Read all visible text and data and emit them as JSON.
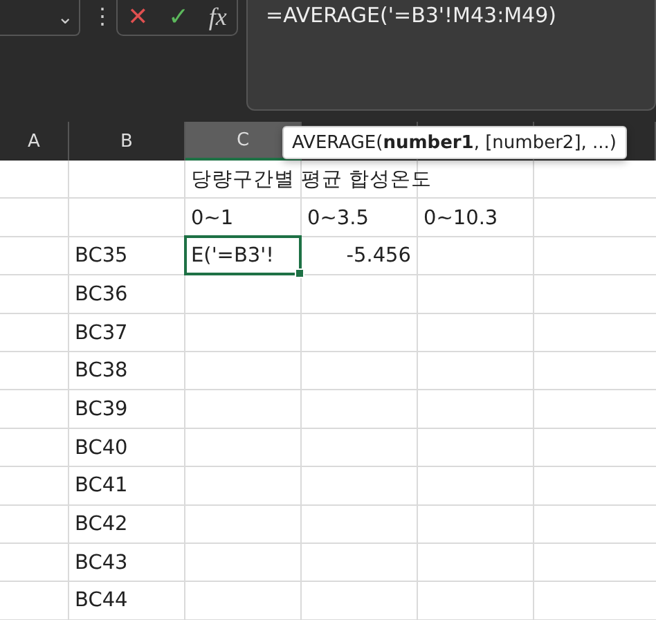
{
  "formula_bar": {
    "name_box": {
      "caret": "⌄"
    },
    "more": "⋮",
    "cancel": "✕",
    "enter": "✓",
    "function_label": "fx",
    "formula": "=AVERAGE('=B3'!M43:M49)"
  },
  "columns": [
    {
      "label": "A",
      "selected": false
    },
    {
      "label": "B",
      "selected": false
    },
    {
      "label": "C",
      "selected": true
    }
  ],
  "tooltip": "AVERAGE(**number1**, [number2], ...)",
  "rows": [
    {
      "cells": [
        null,
        null,
        {
          "text": "당량구간별 평균 합성온도",
          "kind": "text"
        },
        null,
        null,
        null
      ]
    },
    {
      "cells": [
        null,
        null,
        {
          "text": "0~1",
          "kind": "text"
        },
        {
          "text": "0~3.5",
          "kind": "text"
        },
        {
          "text": "0~10.3",
          "kind": "text"
        },
        null
      ]
    },
    {
      "cells": [
        null,
        {
          "text": "BC35",
          "kind": "text"
        },
        {
          "text": "E('=B3'!",
          "kind": "editing"
        },
        {
          "text": "-5.456",
          "kind": "number"
        },
        null,
        null
      ]
    },
    {
      "cells": [
        null,
        {
          "text": "BC36",
          "kind": "text"
        },
        null,
        null,
        null,
        null
      ]
    },
    {
      "cells": [
        null,
        {
          "text": "BC37",
          "kind": "text"
        },
        null,
        null,
        null,
        null
      ]
    },
    {
      "cells": [
        null,
        {
          "text": "BC38",
          "kind": "text"
        },
        null,
        null,
        null,
        null
      ]
    },
    {
      "cells": [
        null,
        {
          "text": "BC39",
          "kind": "text"
        },
        null,
        null,
        null,
        null
      ]
    },
    {
      "cells": [
        null,
        {
          "text": "BC40",
          "kind": "text"
        },
        null,
        null,
        null,
        null
      ]
    },
    {
      "cells": [
        null,
        {
          "text": "BC41",
          "kind": "text"
        },
        null,
        null,
        null,
        null
      ]
    },
    {
      "cells": [
        null,
        {
          "text": "BC42",
          "kind": "text"
        },
        null,
        null,
        null,
        null
      ]
    },
    {
      "cells": [
        null,
        {
          "text": "BC43",
          "kind": "text"
        },
        null,
        null,
        null,
        null
      ]
    },
    {
      "cells": [
        null,
        {
          "text": "BC44",
          "kind": "text"
        },
        null,
        null,
        null,
        null
      ]
    }
  ]
}
